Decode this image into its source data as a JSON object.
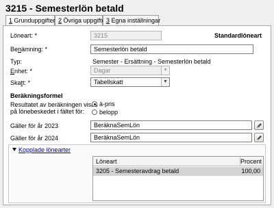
{
  "header": {
    "title": "3215 - Semesterlön betald"
  },
  "tabs": [
    {
      "key": "1",
      "label": " Grunduppgifter",
      "active": true
    },
    {
      "key": "2",
      "label": " Övriga uppgifter",
      "active": false
    },
    {
      "key": "3",
      "label": " Egna inställningar",
      "active": false
    }
  ],
  "form": {
    "loneart_label": "Löneart: *",
    "loneart_value": "3215",
    "standard_label": "Standardlöneart",
    "benamning_label_pre": "Be",
    "benamning_label_key": "n",
    "benamning_label_post": "ämning: *",
    "benamning_value": "Semesterlön betald",
    "typ_label": "Typ:",
    "typ_value": "Semester - Ersättning - Semesterlön betald",
    "enhet_label_key": "E",
    "enhet_label_post": "nhet: *",
    "enhet_value": "Dagar",
    "skatt_label_pre": "Ska",
    "skatt_label_key": "t",
    "skatt_label_post": "t: *",
    "skatt_value": "Tabellskatt"
  },
  "berakning": {
    "section_title": "Beräkningsformel",
    "desc_line1": "Resultatet av beräkningen visas",
    "desc_line2": "på lönebeskedet i fältet för:",
    "option_apris": "à-pris",
    "option_belopp": "belopp",
    "selected": "à-pris",
    "galler_2023_label": "Gäller för år 2023",
    "galler_2023_value": "BeräknaSemLön",
    "galler_2024_label": "Gäller för år 2024",
    "galler_2024_value": "BeräknaSemLön"
  },
  "kopplade": {
    "toggle_label": "Kopplade lönearter",
    "columns": [
      "Löneart",
      "Procent"
    ],
    "rows": [
      {
        "loneart": "3205 - Semesteravdrag betald",
        "procent": "100,00"
      }
    ]
  },
  "icons": {
    "pen": "pencil-icon",
    "dropdown": "chevron-down-icon",
    "expand": "triangle-down-icon"
  }
}
